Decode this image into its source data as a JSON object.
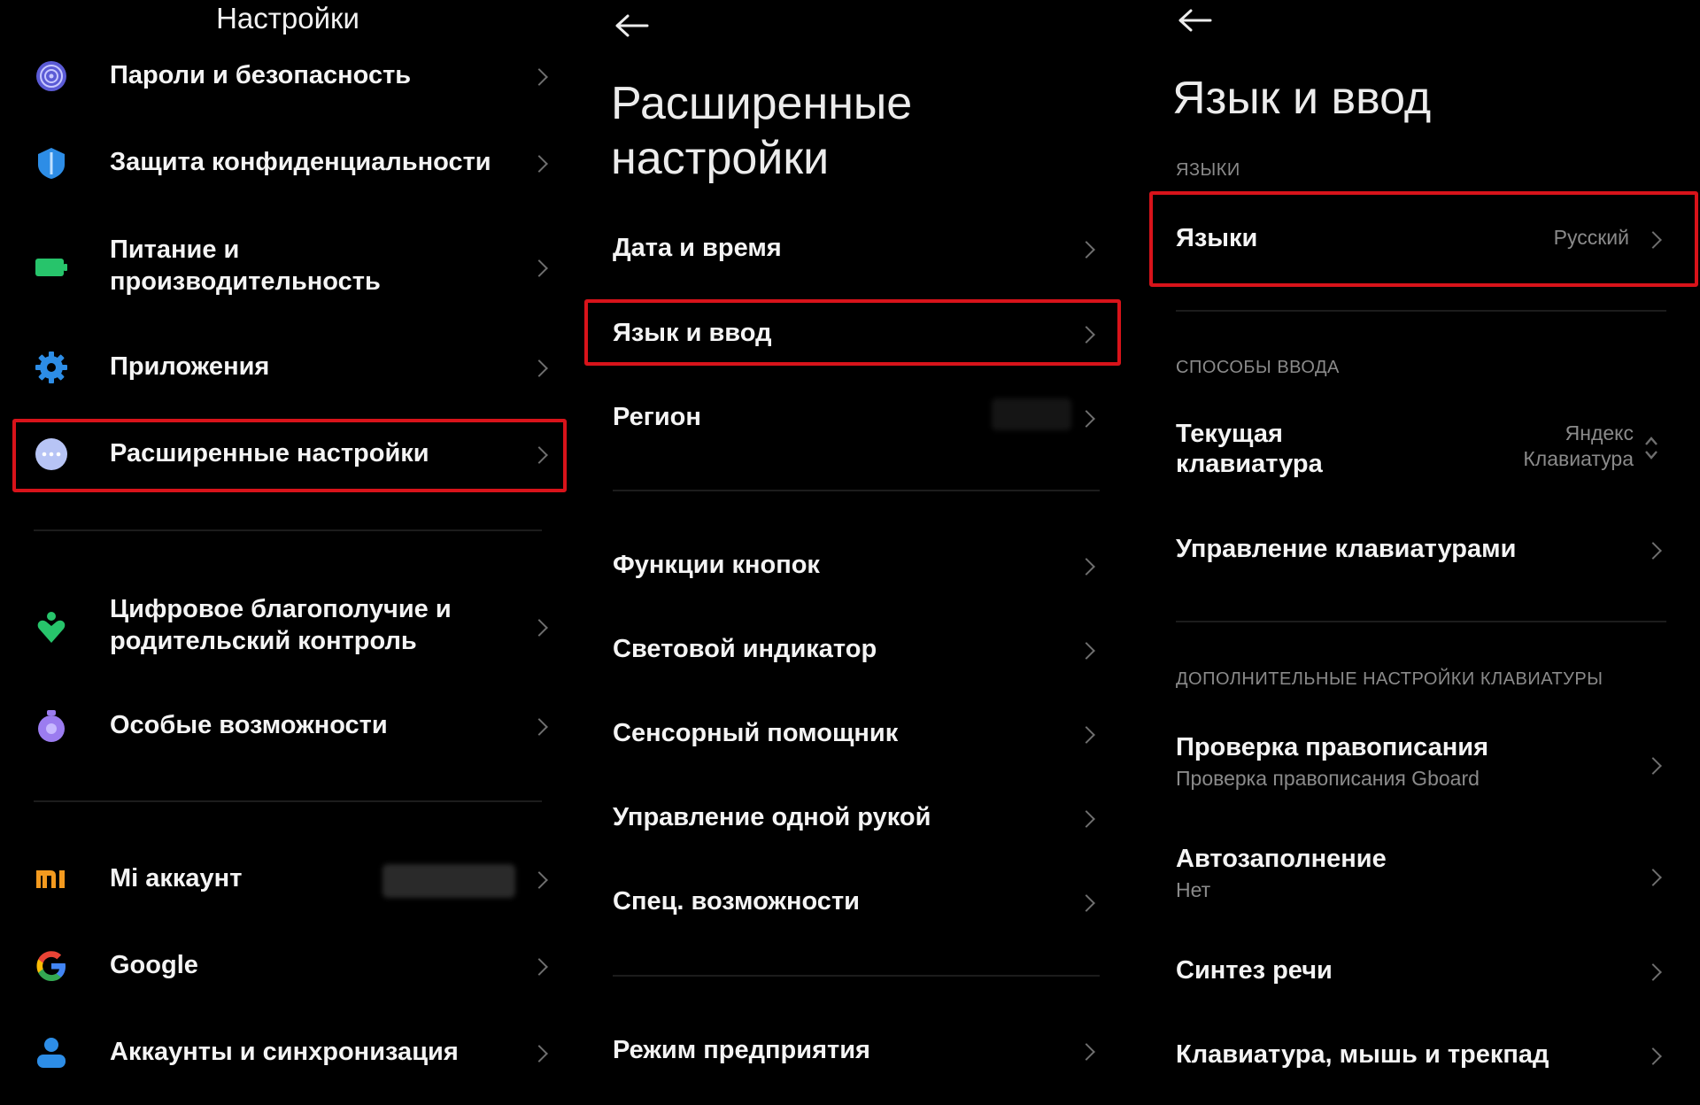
{
  "panel1": {
    "title": "Настройки",
    "items": [
      {
        "label": "Пароли и безопасность"
      },
      {
        "label": "Защита конфиденциальности"
      },
      {
        "label": "Питание и производительность"
      },
      {
        "label": "Приложения"
      },
      {
        "label": "Расширенные настройки"
      },
      {
        "label": "Цифровое благополучие и родительский контроль"
      },
      {
        "label": "Особые возможности"
      },
      {
        "label": "Mi аккаунт"
      },
      {
        "label": "Google"
      },
      {
        "label": "Аккаунты и синхронизация"
      }
    ],
    "line_a": "Питание и",
    "line_b": "производительность",
    "line_c": "Цифровое благополучие и",
    "line_d": "родительский контроль",
    "highlighted": "Расширенные настройки",
    "icons": [
      "fingerprint-icon",
      "privacy-shield-icon",
      "battery-icon",
      "gear-icon",
      "more-dots-icon",
      "wellbeing-icon",
      "accessibility-icon",
      "mi-logo-icon",
      "google-logo-icon",
      "person-icon"
    ],
    "accent": "#d8131a"
  },
  "panel2": {
    "title_line1": "Расширенные",
    "title_line2": "настройки",
    "items": [
      {
        "label": "Дата и время"
      },
      {
        "label": "Язык и ввод"
      },
      {
        "label": "Регион"
      },
      {
        "label": "Функции кнопок"
      },
      {
        "label": "Световой индикатор"
      },
      {
        "label": "Сенсорный помощник"
      },
      {
        "label": "Управление одной рукой"
      },
      {
        "label": "Спец. возможности"
      },
      {
        "label": "Режим предприятия"
      }
    ],
    "highlighted": "Язык и ввод"
  },
  "panel3": {
    "title": "Язык и ввод",
    "sections": [
      "ЯЗЫКИ",
      "СПОСОБЫ ВВОДА",
      "ДОПОЛНИТЕЛЬНЫЕ НАСТРОЙКИ КЛАВИАТУРЫ"
    ],
    "languages": {
      "label": "Языки",
      "value": "Русский"
    },
    "current_keyboard": {
      "line1": "Текущая",
      "line2": "клавиатура",
      "value_line1": "Яндекс",
      "value_line2": "Клавиатура"
    },
    "manage_keyboards": {
      "label": "Управление клавиатурами"
    },
    "spell_check": {
      "label": "Проверка правописания",
      "sub": "Проверка правописания Gboard"
    },
    "autofill": {
      "label": "Автозаполнение",
      "sub": "Нет"
    },
    "tts": {
      "label": "Синтез речи"
    },
    "kbd_mouse": {
      "label": "Клавиатура, мышь и трекпад"
    }
  }
}
